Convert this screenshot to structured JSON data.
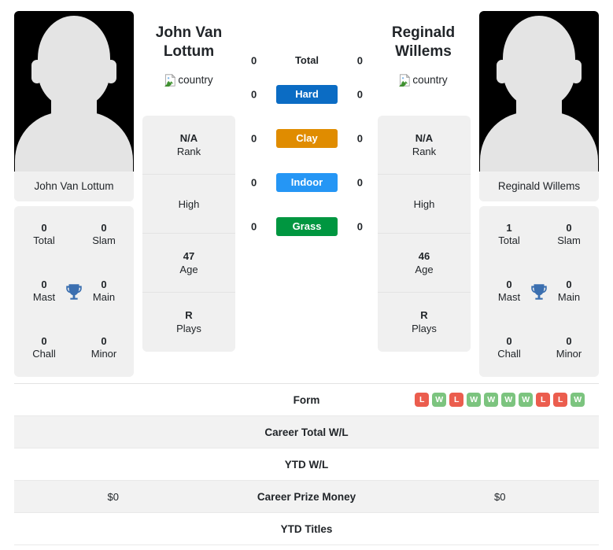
{
  "players": [
    {
      "name": "John Van Lottum",
      "name_display": "John Van\nLottum",
      "country_alt": "country",
      "titles": [
        {
          "value": "0",
          "label": "Total"
        },
        {
          "value": "0",
          "label": "Slam"
        },
        {
          "value": "0",
          "label": "Mast"
        },
        {
          "value": "0",
          "label": "Main"
        },
        {
          "value": "0",
          "label": "Chall"
        },
        {
          "value": "0",
          "label": "Minor"
        }
      ],
      "info": [
        {
          "value": "N/A",
          "label": "Rank"
        },
        {
          "value": "",
          "label": "High"
        },
        {
          "value": "47",
          "label": "Age"
        },
        {
          "value": "R",
          "label": "Plays"
        }
      ]
    },
    {
      "name": "Reginald Willems",
      "name_display": "Reginald\nWillems",
      "country_alt": "country",
      "titles": [
        {
          "value": "1",
          "label": "Total"
        },
        {
          "value": "0",
          "label": "Slam"
        },
        {
          "value": "0",
          "label": "Mast"
        },
        {
          "value": "0",
          "label": "Main"
        },
        {
          "value": "0",
          "label": "Chall"
        },
        {
          "value": "0",
          "label": "Minor"
        }
      ],
      "info": [
        {
          "value": "N/A",
          "label": "Rank"
        },
        {
          "value": "",
          "label": "High"
        },
        {
          "value": "46",
          "label": "Age"
        },
        {
          "value": "R",
          "label": "Plays"
        }
      ]
    }
  ],
  "surfaces": [
    {
      "label": "Total",
      "left": "0",
      "right": "0",
      "color": "",
      "pill": false
    },
    {
      "label": "Hard",
      "left": "0",
      "right": "0",
      "color": "#0b6cc4",
      "pill": true
    },
    {
      "label": "Clay",
      "left": "0",
      "right": "0",
      "color": "#e08c00",
      "pill": true
    },
    {
      "label": "Indoor",
      "left": "0",
      "right": "0",
      "color": "#2596f5",
      "pill": true
    },
    {
      "label": "Grass",
      "left": "0",
      "right": "0",
      "color": "#009640",
      "pill": true
    }
  ],
  "comparison_rows": [
    {
      "label": "Form",
      "left": "",
      "right": "",
      "left_form": [],
      "right_form": [
        "L",
        "W",
        "L",
        "W",
        "W",
        "W",
        "W",
        "L",
        "L",
        "W"
      ],
      "striped": false
    },
    {
      "label": "Career Total W/L",
      "left": "",
      "right": "",
      "left_form": [],
      "right_form": [],
      "striped": true
    },
    {
      "label": "YTD W/L",
      "left": "",
      "right": "",
      "left_form": [],
      "right_form": [],
      "striped": false
    },
    {
      "label": "Career Prize Money",
      "left": "$0",
      "right": "$0",
      "left_form": [],
      "right_form": [],
      "striped": true
    },
    {
      "label": "YTD Titles",
      "left": "",
      "right": "",
      "left_form": [],
      "right_form": [],
      "striped": false
    }
  ],
  "colors": {
    "badge_win": "#7cc47f",
    "badge_loss": "#eb5d4e",
    "trophy": "#3b6fb0",
    "card_bg": "#f0f0f0",
    "stripe_bg": "#f2f2f2"
  }
}
